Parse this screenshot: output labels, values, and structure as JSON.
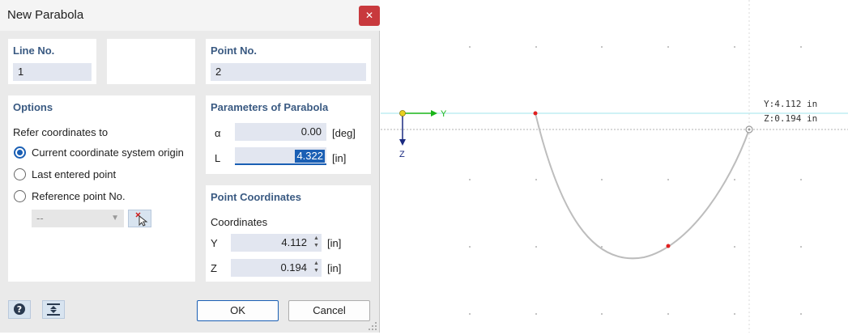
{
  "dialog": {
    "title": "New Parabola",
    "close_icon": "close-icon"
  },
  "line_no": {
    "label": "Line No.",
    "value": "1"
  },
  "point_no": {
    "label": "Point No.",
    "value": "2"
  },
  "options": {
    "title": "Options",
    "refer_label": "Refer coordinates to",
    "radios": [
      {
        "label": "Current coordinate system origin",
        "selected": true
      },
      {
        "label": "Last entered point",
        "selected": false
      },
      {
        "label": "Reference point No.",
        "selected": false
      }
    ],
    "reference_select": "--"
  },
  "parameters": {
    "title": "Parameters of Parabola",
    "alpha": {
      "label": "α",
      "value": "0.00",
      "unit": "[deg]"
    },
    "length": {
      "label": "L",
      "value": "4.322",
      "unit": "[in]"
    }
  },
  "point_coords": {
    "title": "Point Coordinates",
    "subtitle": "Coordinates",
    "y": {
      "label": "Y",
      "value": "4.112",
      "unit": "[in]"
    },
    "z": {
      "label": "Z",
      "value": "0.194",
      "unit": "[in]"
    }
  },
  "footer": {
    "help_icon": "help-icon",
    "pick_icon": "pick-plane-icon",
    "ok_label": "OK",
    "cancel_label": "Cancel"
  },
  "canvas": {
    "axis_y_label": "Y",
    "axis_z_label": "Z",
    "readout_y": "Y:4.112 in",
    "readout_z": "Z:0.194 in",
    "accent_color": "#1a5fb4",
    "point_color": "#e02020",
    "curve_color": "#b8b8b8"
  }
}
